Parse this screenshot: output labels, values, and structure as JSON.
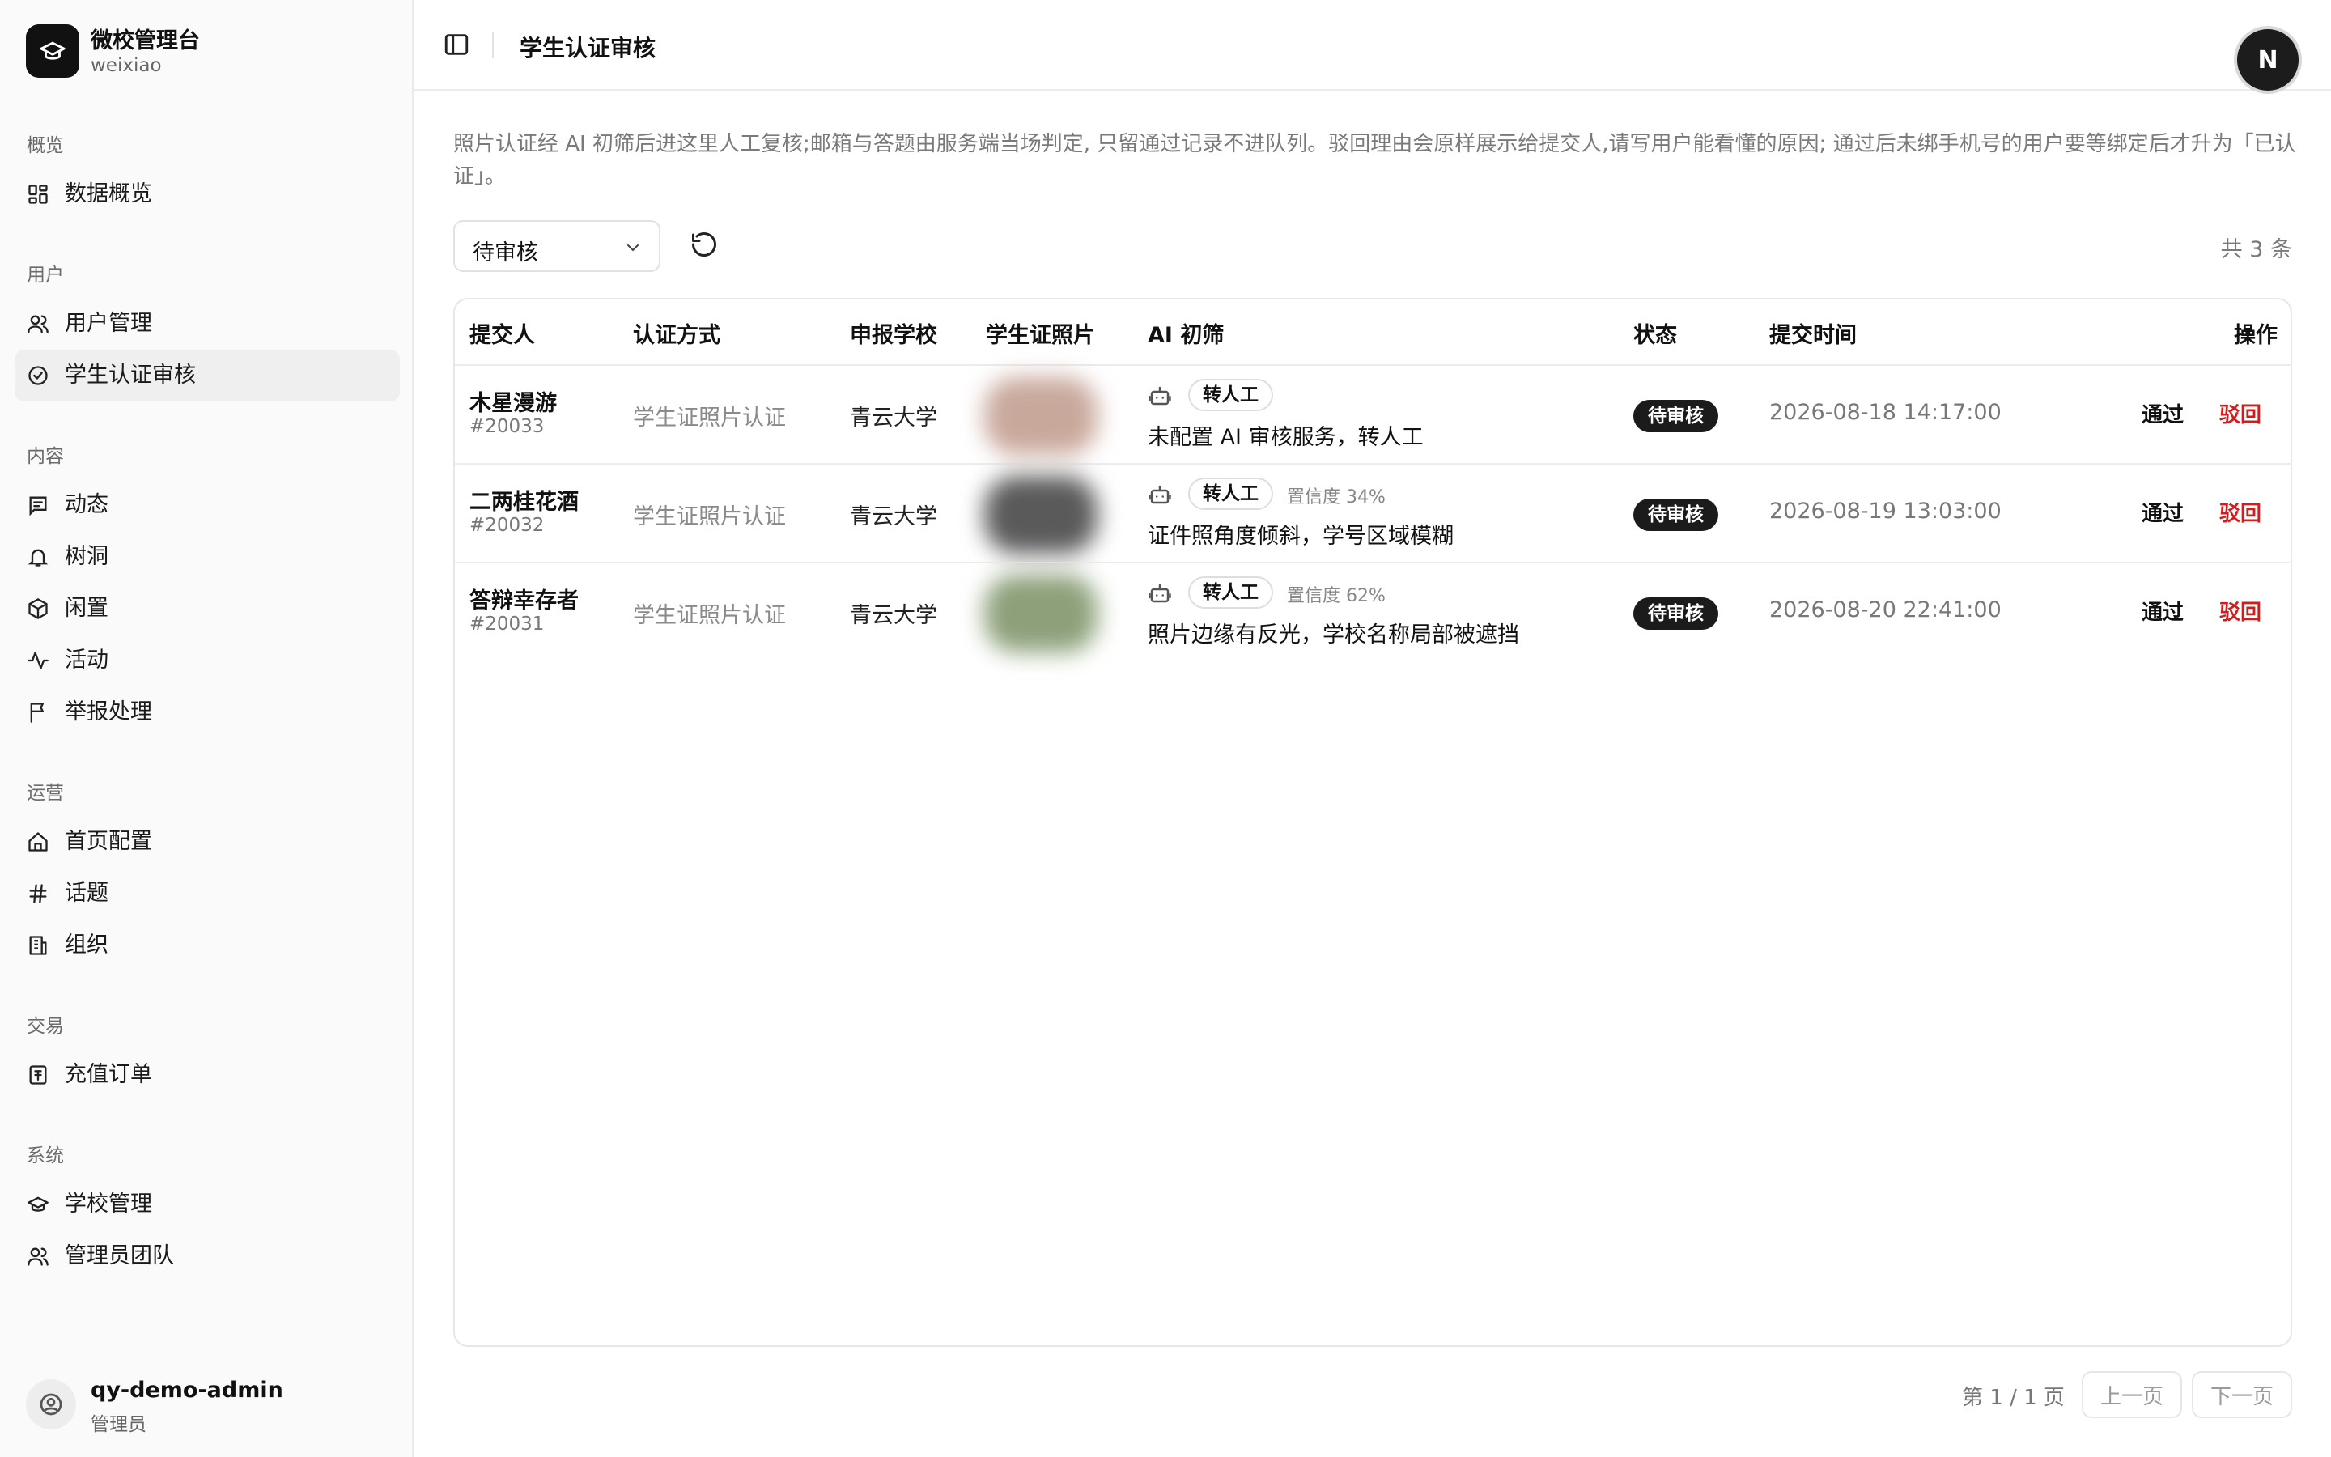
{
  "brand": {
    "title": "微校管理台",
    "subtitle": "weixiao"
  },
  "sidebar": {
    "groups": [
      {
        "label": "概览",
        "items": [
          {
            "label": "数据概览",
            "icon": "dashboard-icon"
          }
        ]
      },
      {
        "label": "用户",
        "items": [
          {
            "label": "用户管理",
            "icon": "users-icon"
          },
          {
            "label": "学生认证审核",
            "icon": "check-circle-icon",
            "active": true
          }
        ]
      },
      {
        "label": "内容",
        "items": [
          {
            "label": "动态",
            "icon": "feed-icon"
          },
          {
            "label": "树洞",
            "icon": "bell-icon"
          },
          {
            "label": "闲置",
            "icon": "box-icon"
          },
          {
            "label": "活动",
            "icon": "activity-icon"
          },
          {
            "label": "举报处理",
            "icon": "flag-icon"
          }
        ]
      },
      {
        "label": "运营",
        "items": [
          {
            "label": "首页配置",
            "icon": "home-icon"
          },
          {
            "label": "话题",
            "icon": "hash-icon"
          },
          {
            "label": "组织",
            "icon": "building-icon"
          }
        ]
      },
      {
        "label": "交易",
        "items": [
          {
            "label": "充值订单",
            "icon": "receipt-icon"
          }
        ]
      },
      {
        "label": "系统",
        "items": [
          {
            "label": "学校管理",
            "icon": "graduation-cap-icon"
          },
          {
            "label": "管理员团队",
            "icon": "team-icon"
          }
        ]
      }
    ]
  },
  "user": {
    "name": "qy-demo-admin",
    "role": "管理员"
  },
  "header": {
    "title": "学生认证审核",
    "avatar_letter": "N"
  },
  "description": "照片认证经 AI 初筛后进这里人工复核;邮箱与答题由服务端当场判定, 只留通过记录不进队列。驳回理由会原样展示给提交人,请写用户能看懂的原因; 通过后未绑手机号的用户要等绑定后才升为「已认证」。",
  "filter": {
    "selected": "待审核"
  },
  "total_label": "共 3 条",
  "table": {
    "columns": [
      "提交人",
      "认证方式",
      "申报学校",
      "学生证照片",
      "AI 初筛",
      "状态",
      "提交时间",
      "操作"
    ],
    "rows": [
      {
        "name": "木星漫游",
        "id": "#20033",
        "method": "学生证照片认证",
        "school": "青云大学",
        "photo_color": "#c9a89c",
        "ai_tag": "转人工",
        "confidence": "",
        "ai_reason": "未配置 AI 审核服务，转人工",
        "status": "待审核",
        "time": "2026-08-18 14:17:00",
        "pass": "通过",
        "reject": "驳回"
      },
      {
        "name": "二两桂花酒",
        "id": "#20032",
        "method": "学生证照片认证",
        "school": "青云大学",
        "photo_color": "#5a5a5a",
        "ai_tag": "转人工",
        "confidence": "置信度 34%",
        "ai_reason": "证件照角度倾斜，学号区域模糊",
        "status": "待审核",
        "time": "2026-08-19 13:03:00",
        "pass": "通过",
        "reject": "驳回"
      },
      {
        "name": "答辩幸存者",
        "id": "#20031",
        "method": "学生证照片认证",
        "school": "青云大学",
        "photo_color": "#8da07a",
        "ai_tag": "转人工",
        "confidence": "置信度 62%",
        "ai_reason": "照片边缘有反光，学校名称局部被遮挡",
        "status": "待审核",
        "time": "2026-08-20 22:41:00",
        "pass": "通过",
        "reject": "驳回"
      }
    ]
  },
  "pagination": {
    "info": "第 1 / 1 页",
    "prev": "上一页",
    "next": "下一页"
  }
}
